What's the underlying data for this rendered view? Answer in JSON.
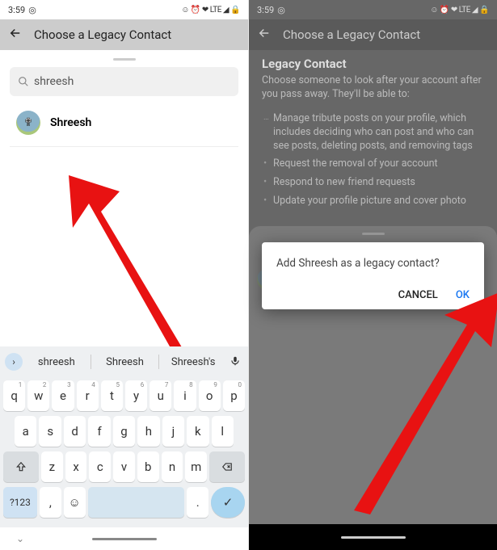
{
  "left": {
    "time": "3:59",
    "statusRight": "☺ ⏰ ❤ LTE ◢ 🔒",
    "header": "Choose a Legacy Contact",
    "searchValue": "shreesh",
    "resultName": "Shreesh",
    "suggestions": [
      "shreesh",
      "Shreesh",
      "Shreesh's"
    ],
    "keysRow1": [
      {
        "k": "q",
        "s": "1"
      },
      {
        "k": "w",
        "s": "2"
      },
      {
        "k": "e",
        "s": "3"
      },
      {
        "k": "r",
        "s": "4"
      },
      {
        "k": "t",
        "s": "5"
      },
      {
        "k": "y",
        "s": "6"
      },
      {
        "k": "u",
        "s": "7"
      },
      {
        "k": "i",
        "s": "8"
      },
      {
        "k": "o",
        "s": "9"
      },
      {
        "k": "p",
        "s": "0"
      }
    ],
    "keysRow2": [
      "a",
      "s",
      "d",
      "f",
      "g",
      "h",
      "j",
      "k",
      "l"
    ],
    "keysRow3": [
      "z",
      "x",
      "c",
      "v",
      "b",
      "n",
      "m"
    ],
    "symKey": "?123",
    "commaKey": ",",
    "emojiKey": "☺",
    "periodKey": ".",
    "enterKey": "✓"
  },
  "right": {
    "time": "3:59",
    "statusRight": "☺ ⏰ ❤ LTE ◢ 🔒",
    "header": "Choose a Legacy Contact",
    "title": "Legacy Contact",
    "intro": "Choose someone to look after your account after you pass away. They'll be able to:",
    "bullets": [
      "Manage tribute posts on your profile, which includes deciding who can post and who can see posts, deleting posts, and removing tags",
      "Request the removal of your account",
      "Respond to new friend requests",
      "Update your profile picture and cover photo"
    ],
    "dialogMsg": "Add Shreesh as a legacy contact?",
    "cancel": "CANCEL",
    "ok": "OK"
  }
}
